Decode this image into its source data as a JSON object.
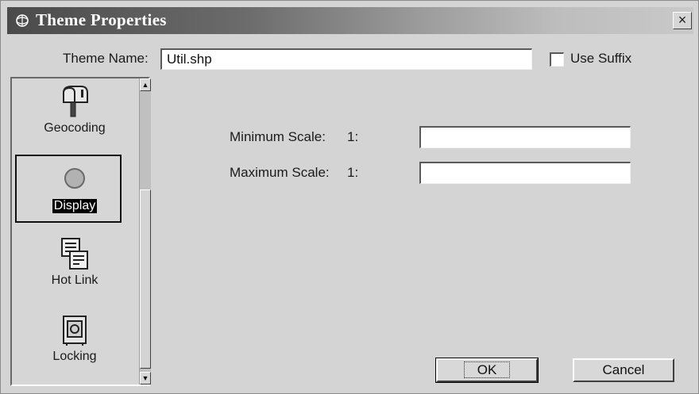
{
  "window": {
    "title": "Theme Properties"
  },
  "header": {
    "theme_name_label": "Theme Name:",
    "theme_name_value": "Util.shp",
    "use_suffix_label": "Use Suffix",
    "use_suffix_checked": false
  },
  "sidebar": {
    "items": [
      {
        "label": "Geocoding",
        "icon": "mailbox-icon",
        "selected": false
      },
      {
        "label": "Display",
        "icon": "circle-icon",
        "selected": true
      },
      {
        "label": "Hot Link",
        "icon": "hotlink-icon",
        "selected": false
      },
      {
        "label": "Locking",
        "icon": "safe-icon",
        "selected": false
      }
    ]
  },
  "display": {
    "min_scale_label": "Minimum Scale:",
    "min_scale_prefix": "1:",
    "min_scale_value": "",
    "max_scale_label": "Maximum Scale:",
    "max_scale_prefix": "1:",
    "max_scale_value": ""
  },
  "buttons": {
    "ok": "OK",
    "cancel": "Cancel"
  }
}
